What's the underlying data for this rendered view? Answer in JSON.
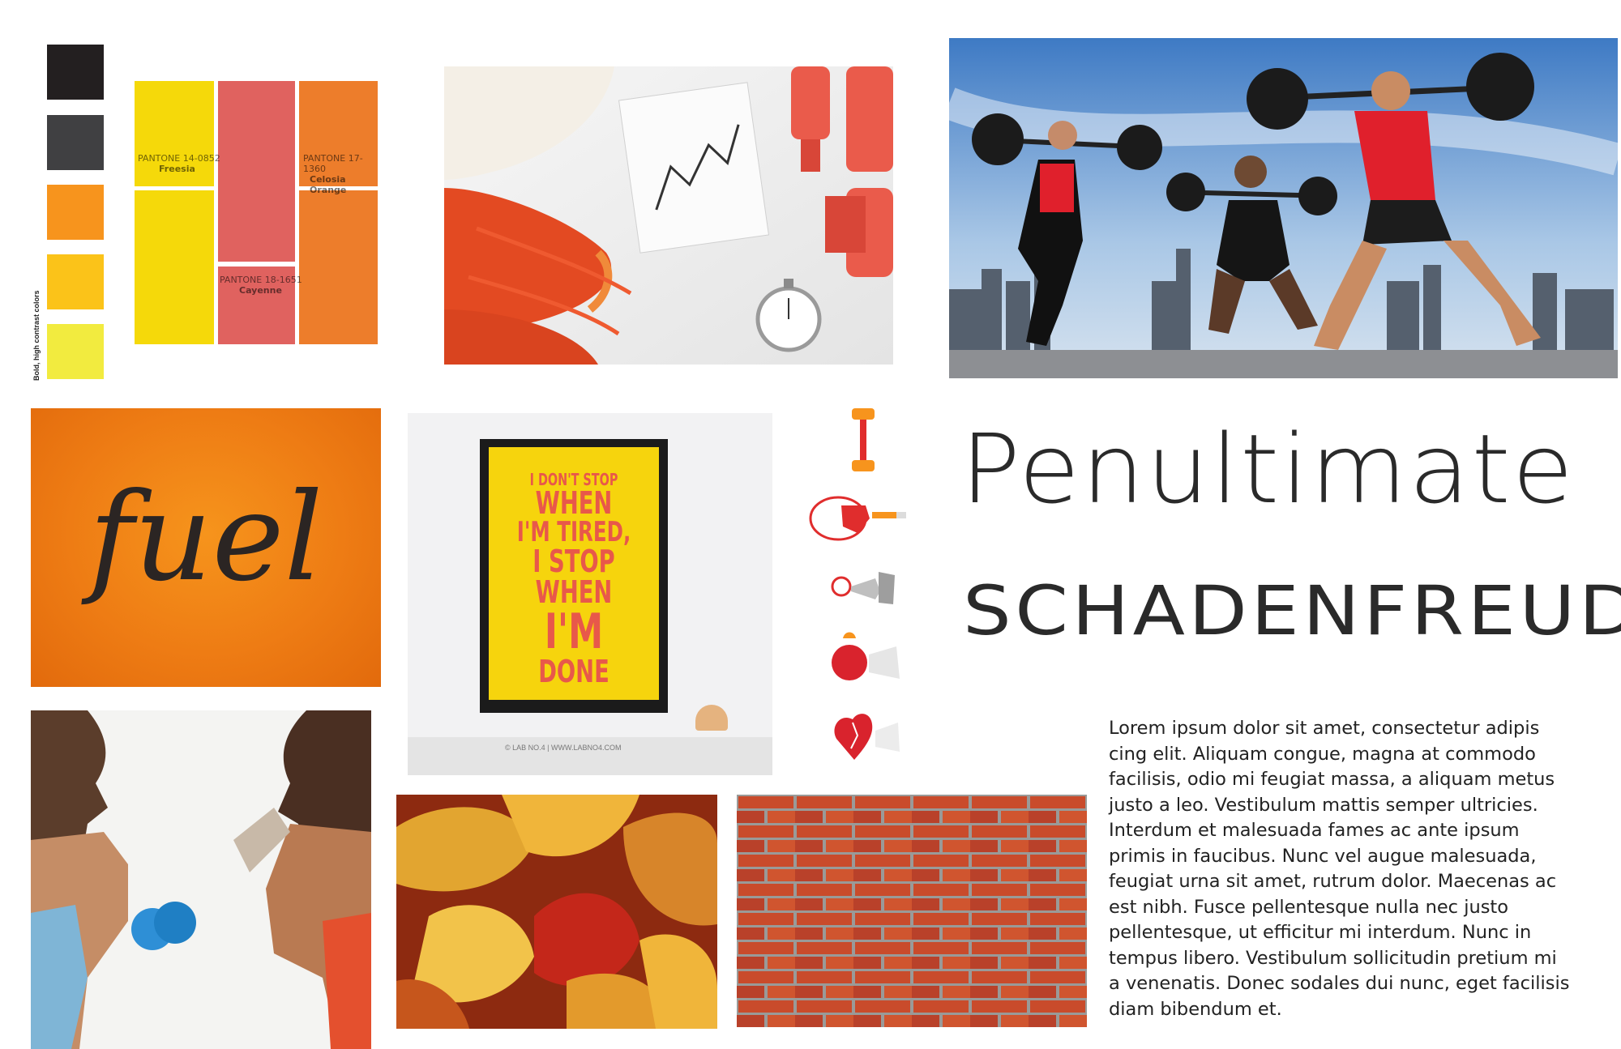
{
  "palette": {
    "swatches": [
      "#231f20",
      "#404042",
      "#f7941d",
      "#fbc319",
      "#f2eb3f"
    ],
    "vertical_label": "Bold, high contrast colors",
    "pantone": [
      {
        "code": "PANTONE 14-0852",
        "name": "Freesia",
        "color": "#f5d90a"
      },
      {
        "code": "PANTONE 18-1651",
        "name": "Cayenne",
        "color": "#e0625f"
      },
      {
        "code": "PANTONE 17-1360",
        "name": "Celosia Orange",
        "color": "#ed7d2b"
      }
    ]
  },
  "fuel": {
    "text": "fuel",
    "color": "#f07e15"
  },
  "poster": {
    "lines": [
      "I DON'T STOP",
      "WHEN",
      "I'M TIRED,",
      "I STOP",
      "WHEN",
      "I'M",
      "DONE"
    ],
    "credit": "© LAB NO.4  |  WWW.LABNO4.COM",
    "bg": "#f6d40d",
    "text_color": "#e8584a"
  },
  "icons": [
    "barbell-icon",
    "runner-icon",
    "hand-grip-icon",
    "apple-icon",
    "heart-icon"
  ],
  "headline": {
    "title": "Penultimate",
    "subtitle": "SCHADENFREUDE"
  },
  "body_lines": [
    "Lorem ipsum dolor sit amet, consectetur adipis",
    "cing elit. Aliquam congue, magna at commodo",
    "facilisis, odio mi feugiat massa, a aliquam metus",
    "justo a leo. Vestibulum mattis semper ultricies.",
    "Interdum et malesuada fames ac ante ipsum",
    "primis in faucibus. Nunc vel augue malesuada,",
    "feugiat urna sit amet, rutrum dolor. Maecenas ac",
    "est nibh. Fusce pellentesque nulla nec justo",
    "pellentesque, ut efficitur mi interdum. Nunc in",
    "tempus libero. Vestibulum sollicitudin pretium mi",
    "a venenatis. Donec sodales dui nunc, eget facilisis",
    "diam bibendum et."
  ]
}
